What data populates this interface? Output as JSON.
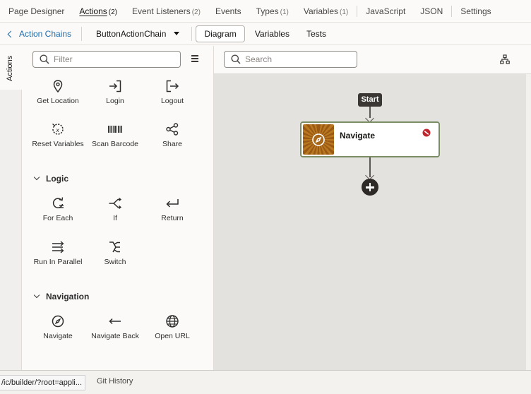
{
  "top_tabs": [
    {
      "label": "Page Designer",
      "count": ""
    },
    {
      "label": "Actions",
      "count": "(2)",
      "active": true
    },
    {
      "label": "Event Listeners",
      "count": "(2)"
    },
    {
      "label": "Events",
      "count": ""
    },
    {
      "label": "Types",
      "count": "(1)"
    },
    {
      "label": "Variables",
      "count": "(1)"
    },
    {
      "label": "JavaScript",
      "count": ""
    },
    {
      "label": "JSON",
      "count": ""
    },
    {
      "label": "Settings",
      "count": ""
    }
  ],
  "second_bar": {
    "back_label": "Action Chains",
    "chain_name": "ButtonActionChain",
    "tabs": [
      "Diagram",
      "Variables",
      "Tests"
    ],
    "active_tab": "Diagram"
  },
  "side_tab": {
    "label": "Actions"
  },
  "palette": {
    "filter_placeholder": "Filter",
    "general_items": [
      {
        "label": "Get Location",
        "icon": "location-pin-icon"
      },
      {
        "label": "Login",
        "icon": "login-icon"
      },
      {
        "label": "Logout",
        "icon": "logout-icon"
      },
      {
        "label": "Reset Variables",
        "icon": "reset-variables-icon"
      },
      {
        "label": "Scan Barcode",
        "icon": "barcode-icon"
      },
      {
        "label": "Share",
        "icon": "share-icon"
      }
    ],
    "logic": {
      "title": "Logic",
      "items": [
        {
          "label": "For Each",
          "icon": "for-each-icon"
        },
        {
          "label": "If",
          "icon": "if-branch-icon"
        },
        {
          "label": "Return",
          "icon": "return-icon"
        },
        {
          "label": "Run In Parallel",
          "icon": "parallel-icon"
        },
        {
          "label": "Switch",
          "icon": "switch-icon"
        }
      ]
    },
    "navigation": {
      "title": "Navigation",
      "items": [
        {
          "label": "Navigate",
          "icon": "compass-icon"
        },
        {
          "label": "Navigate Back",
          "icon": "back-arrow-icon"
        },
        {
          "label": "Open URL",
          "icon": "globe-icon"
        }
      ]
    }
  },
  "canvas": {
    "search_placeholder": "Search",
    "start_label": "Start",
    "node": {
      "title": "Navigate",
      "icon": "compass-icon",
      "status": "error"
    }
  },
  "bottom": {
    "git_history": "Git History",
    "url_tooltip": "/ic/builder/?root=appli..."
  },
  "colors": {
    "link": "#1f6cac",
    "node_border": "#7c8e66",
    "error": "#c0262d",
    "thumb": "#a8651a"
  }
}
